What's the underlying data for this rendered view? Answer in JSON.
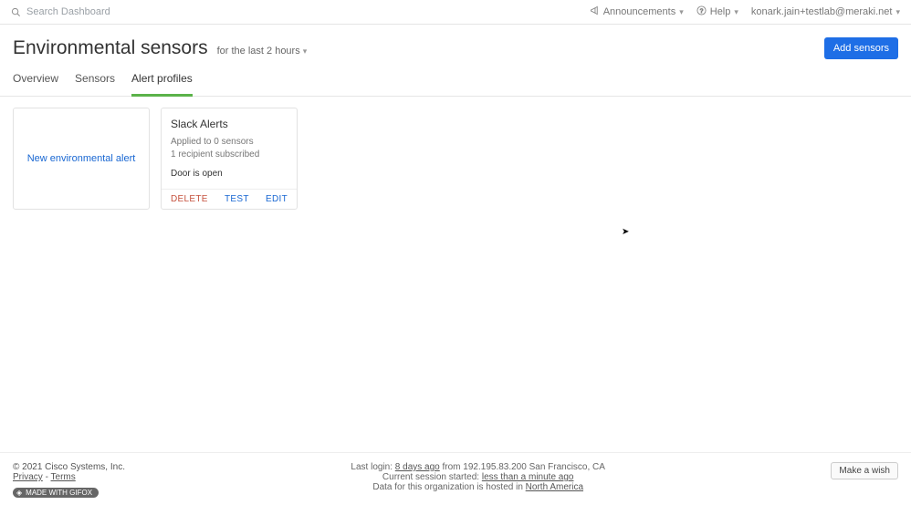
{
  "topbar": {
    "search_placeholder": "Search Dashboard",
    "announcements": "Announcements",
    "help": "Help",
    "user_email": "konark.jain+testlab@meraki.net"
  },
  "header": {
    "title": "Environmental sensors",
    "time_range": "for the last 2 hours",
    "add_button": "Add sensors"
  },
  "tabs": {
    "overview": "Overview",
    "sensors": "Sensors",
    "alert_profiles": "Alert profiles"
  },
  "new_alert_card": {
    "label": "New environmental alert"
  },
  "profile_card": {
    "name": "Slack Alerts",
    "applied": "Applied to 0 sensors",
    "recipients": "1 recipient subscribed",
    "condition": "Door is open",
    "actions": {
      "delete": "DELETE",
      "test": "TEST",
      "edit": "EDIT"
    }
  },
  "footer": {
    "copyright": "© 2021 Cisco Systems, Inc.",
    "privacy": "Privacy",
    "terms": "Terms",
    "login_prefix": "Last login: ",
    "login_link": "8 days ago",
    "login_suffix": " from 192.195.83.200 San Francisco, CA",
    "session_prefix": "Current session started: ",
    "session_link": "less than a minute ago",
    "hosted_prefix": "Data for this organization is hosted in ",
    "hosted_link": "North America",
    "wish": "Make a wish",
    "gifox": "MADE WITH GIFOX"
  }
}
